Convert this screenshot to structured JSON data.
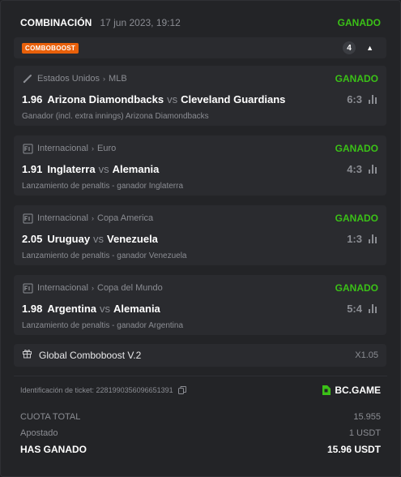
{
  "header": {
    "title": "COMBINACIÓN",
    "date": "17 jun 2023, 19:12",
    "status": "GANADO"
  },
  "comboboost": {
    "badge": "COMBOBOOST",
    "count": "4"
  },
  "selections": [
    {
      "sport_icon": "baseball-bat-icon",
      "region": "Estados Unidos",
      "league": "MLB",
      "status": "GANADO",
      "odds": "1.96",
      "home": "Arizona Diamondbacks",
      "vs": "vs",
      "away": "Cleveland Guardians",
      "score": "6:3",
      "market": "Ganador (incl. extra innings) Arizona Diamondbacks"
    },
    {
      "sport_icon": "fifa-icon",
      "region": "Internacional",
      "league": "Euro",
      "status": "GANADO",
      "odds": "1.91",
      "home": "Inglaterra",
      "vs": "vs",
      "away": "Alemania",
      "score": "4:3",
      "market": "Lanzamiento de penaltis - ganador Inglaterra"
    },
    {
      "sport_icon": "fifa-icon",
      "region": "Internacional",
      "league": "Copa America",
      "status": "GANADO",
      "odds": "2.05",
      "home": "Uruguay",
      "vs": "vs",
      "away": "Venezuela",
      "score": "1:3",
      "market": "Lanzamiento de penaltis - ganador Venezuela"
    },
    {
      "sport_icon": "fifa-icon",
      "region": "Internacional",
      "league": "Copa del Mundo",
      "status": "GANADO",
      "odds": "1.98",
      "home": "Argentina",
      "vs": "vs",
      "away": "Alemania",
      "score": "5:4",
      "market": "Lanzamiento de penaltis - ganador Argentina"
    }
  ],
  "global_boost": {
    "name": "Global Comboboost V.2",
    "multiplier": "X1.05"
  },
  "ticket": {
    "label": "Identificación de ticket: 2281990356096651391",
    "logo_text": "BC.GAME"
  },
  "summary": {
    "total_odds_label": "CUOTA TOTAL",
    "total_odds_value": "15.955",
    "stake_label": "Apostado",
    "stake_value": "1 USDT",
    "win_label": "HAS GANADO",
    "win_value": "15.96 USDT"
  },
  "colors": {
    "win_green": "#3bc117",
    "boost_orange": "#e8600a",
    "muted": "#8b8d93"
  }
}
